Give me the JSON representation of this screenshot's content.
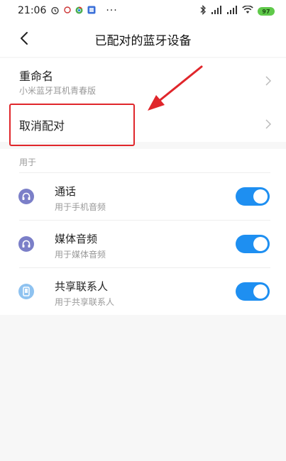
{
  "status_bar": {
    "time": "21:06",
    "dots": "···",
    "battery": "97"
  },
  "header": {
    "title": "已配对的蓝牙设备"
  },
  "rename": {
    "title": "重命名",
    "device_name": "小米蓝牙耳机青春版"
  },
  "unpair": {
    "title": "取消配对"
  },
  "use_section": {
    "label": "用于",
    "items": [
      {
        "title": "通话",
        "subtitle": "用于手机音频",
        "icon": "headset-icon",
        "enabled": true
      },
      {
        "title": "媒体音频",
        "subtitle": "用于媒体音频",
        "icon": "headphone-icon",
        "enabled": true
      },
      {
        "title": "共享联系人",
        "subtitle": "用于共享联系人",
        "icon": "phone-contacts-icon",
        "enabled": true
      }
    ]
  },
  "colors": {
    "accent": "#1e8ff1",
    "highlight": "#e0262b",
    "icon_purple": "#7b7fc8",
    "icon_blue": "#8ec2f0"
  }
}
